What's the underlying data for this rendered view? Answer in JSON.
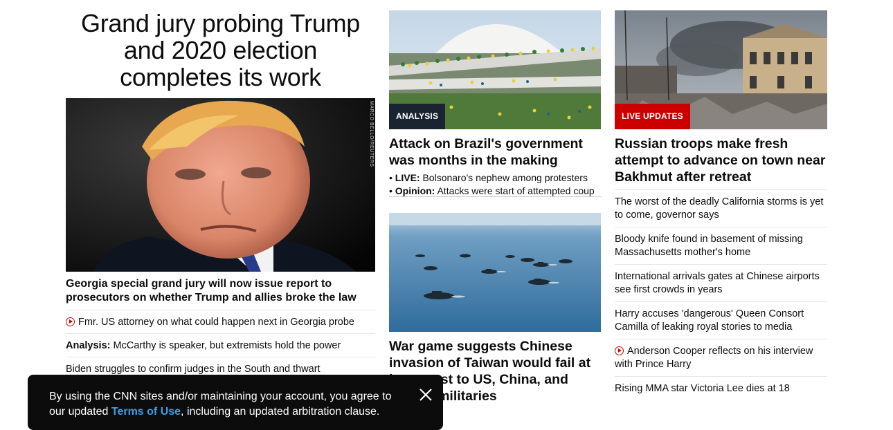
{
  "hero": {
    "headline": "Grand jury probing Trump and 2020 election completes its work",
    "image_credit": "MARCO BELLO/REUTERS",
    "subheadline": "Georgia special grand jury will now issue report to prosecutors on whether Trump and allies broke the law",
    "related": [
      {
        "video": true,
        "prefix": "",
        "text": "Fmr. US attorney on what could happen next in Georgia probe"
      },
      {
        "video": false,
        "prefix": "Analysis:",
        "text": " McCarthy is speaker, but extremists hold the power"
      },
      {
        "video": false,
        "prefix": "",
        "text": "Biden struggles to confirm judges in the South and thwart"
      }
    ]
  },
  "brazil": {
    "label": "ANALYSIS",
    "headline": "Attack on Brazil's government was months in the making",
    "bullets": [
      {
        "prefix": "LIVE:",
        "text": " Bolsonaro's nephew among protesters"
      },
      {
        "prefix": "Opinion:",
        "text": " Attacks were start of attempted coup"
      }
    ]
  },
  "taiwan": {
    "headline": "War game suggests Chinese invasion of Taiwan would fail at huge cost to US, China, and Taiwan militaries"
  },
  "russia": {
    "label": "LIVE UPDATES",
    "headline": "Russian troops make fresh attempt to advance on town near Bakhmut after retreat",
    "stories": [
      {
        "video": false,
        "text": "The worst of the deadly California storms is yet to come, governor says"
      },
      {
        "video": false,
        "text": "Bloody knife found in basement of missing Massachusetts mother's home"
      },
      {
        "video": false,
        "text": "International arrivals gates at Chinese airports see first crowds in years"
      },
      {
        "video": false,
        "text": "Harry accuses 'dangerous' Queen Consort Camilla of leaking royal stories to media"
      },
      {
        "video": true,
        "text": "Anderson Cooper reflects on his interview with Prince Harry"
      },
      {
        "video": false,
        "text": "Rising MMA star Victoria Lee dies at 18"
      }
    ]
  },
  "cookie_banner": {
    "text_before": "By using the CNN sites and/or maintaining your account, you agree to our updated ",
    "link_text": "Terms of Use",
    "text_after": ", including an updated arbitration clause.",
    "close_icon": "close-icon"
  },
  "colors": {
    "live_red": "#cc0000",
    "analysis_navy": "#1a2331",
    "link_blue": "#3d9ee4",
    "banner_bg": "#0c0c0c"
  }
}
